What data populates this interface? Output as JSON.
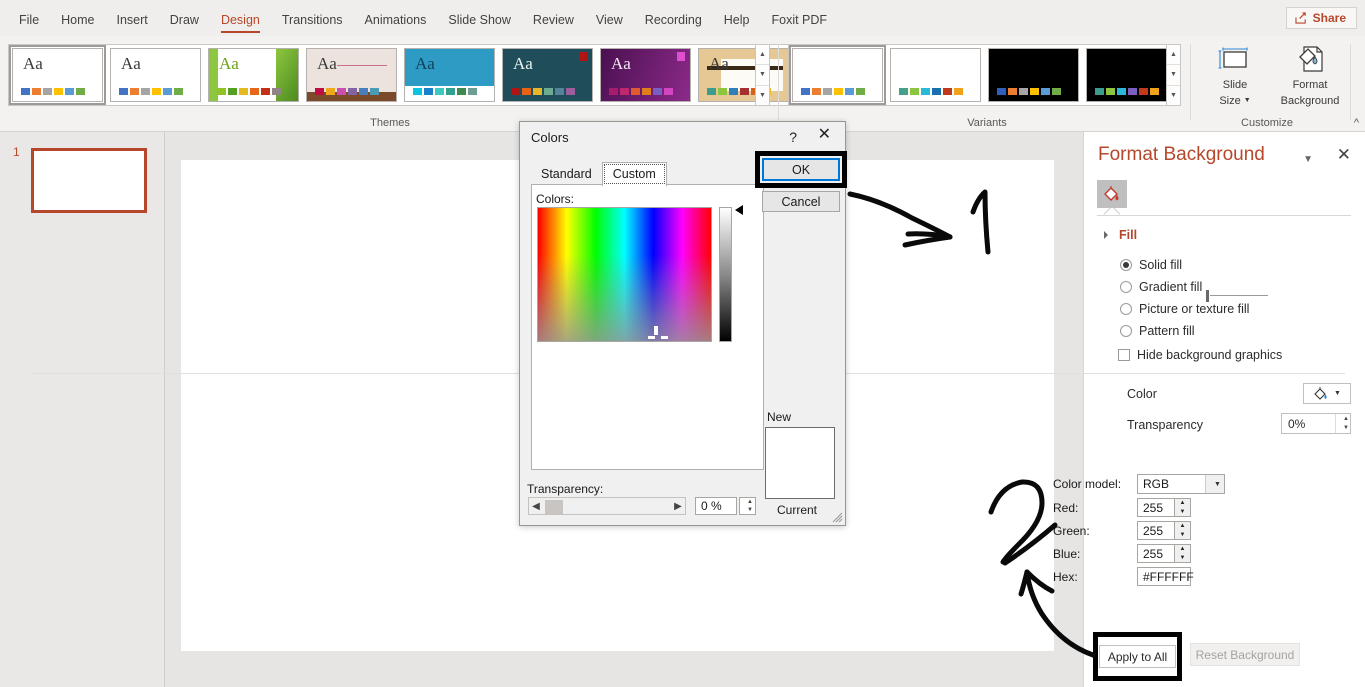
{
  "titlebar": {
    "share_label": "Share",
    "share_icon": "share-icon"
  },
  "ribbon": {
    "tabs": [
      {
        "label": "File"
      },
      {
        "label": "Home"
      },
      {
        "label": "Insert"
      },
      {
        "label": "Draw"
      },
      {
        "label": "Design"
      },
      {
        "label": "Transitions"
      },
      {
        "label": "Animations"
      },
      {
        "label": "Slide Show"
      },
      {
        "label": "Review"
      },
      {
        "label": "View"
      },
      {
        "label": "Recording"
      },
      {
        "label": "Help"
      },
      {
        "label": "Foxit PDF"
      }
    ],
    "active_tab": "Design",
    "groups": {
      "themes_label": "Themes",
      "variants_label": "Variants",
      "customize_label": "Customize"
    },
    "themes": [
      {
        "name": "office-theme",
        "aa": "Aa",
        "bg": "#ffffff",
        "fg": "#3a3a3a",
        "swatches": [
          "#4472c4",
          "#ed7d31",
          "#a5a5a5",
          "#ffc000",
          "#5b9bd5",
          "#70ad47"
        ]
      },
      {
        "name": "office-theme-2",
        "aa": "Aa",
        "bg": "#ffffff",
        "fg": "#3a3a3a",
        "swatches": [
          "#4472c4",
          "#ed7d31",
          "#a5a5a5",
          "#ffc000",
          "#5b9bd5",
          "#70ad47"
        ]
      },
      {
        "name": "facet-theme",
        "aa": "Aa",
        "bg": "#ffffff",
        "fg": "#6aa313",
        "swatches": [
          "#90c226",
          "#54a021",
          "#e6b91e",
          "#e76618",
          "#c42f1a",
          "#918485"
        ]
      },
      {
        "name": "wisp-theme",
        "aa": "Aa",
        "bg": "#ece3de",
        "fg": "#2b2b2b",
        "swatches": [
          "#bf0c43",
          "#f0a81a",
          "#cc4fad",
          "#8264a0",
          "#4a7ebb",
          "#4a9bb5"
        ]
      },
      {
        "name": "badge-theme",
        "aa": "Aa",
        "bg": "#2e9bc5",
        "fg": "#13405c",
        "swatches": [
          "#0ec3e0",
          "#1a82c9",
          "#3ec9c0",
          "#31a190",
          "#3f8a4f",
          "#6c9e93"
        ]
      },
      {
        "name": "ion-boardroom-dark",
        "aa": "Aa",
        "bg": "#1f4e5a",
        "fg": "#e9f1f2",
        "swatches": [
          "#b01513",
          "#ea6312",
          "#e6b729",
          "#6bab90",
          "#55839a",
          "#9e5d9d"
        ]
      },
      {
        "name": "berlin-theme",
        "aa": "Aa",
        "bg": "#6b1f6e",
        "fg": "#f3e8f4",
        "swatches": [
          "#a61c6a",
          "#c0286e",
          "#dd5b2e",
          "#e07d1d",
          "#7a5ec2",
          "#d445c4"
        ]
      },
      {
        "name": "wood-type-theme",
        "aa": "Aa",
        "bg": "#e6c894",
        "fg": "#2b2b2b",
        "swatches": [
          "#3c9c8e",
          "#8cbf3f",
          "#2e80b8",
          "#a63030",
          "#d4621d",
          "#e8bb2a"
        ]
      }
    ],
    "variants": [
      {
        "name": "variant-white-1",
        "bg": "#ffffff",
        "swatches": [
          "#4472c4",
          "#ed7d31",
          "#a5a5a5",
          "#ffc000",
          "#5b9bd5",
          "#70ad47"
        ]
      },
      {
        "name": "variant-white-2",
        "bg": "#ffffff",
        "swatches": [
          "#43a08a",
          "#8cc63e",
          "#29b8d8",
          "#1a6fad",
          "#c0391b",
          "#f0a21a"
        ]
      },
      {
        "name": "variant-black-1",
        "bg": "#000000",
        "swatches": [
          "#2f5fbd",
          "#ed7d31",
          "#a5a5a5",
          "#ffc000",
          "#5b9bd5",
          "#70ad47"
        ]
      },
      {
        "name": "variant-black-2",
        "bg": "#000000",
        "swatches": [
          "#3c9c8e",
          "#8cc63e",
          "#29b8d8",
          "#7a5ec2",
          "#c0391b",
          "#f0a21a"
        ]
      }
    ],
    "customize": {
      "slide_size_label": "Slide\nSize",
      "slide_size_line1": "Slide",
      "slide_size_line2": "Size",
      "format_background_line1": "Format",
      "format_background_line2": "Background",
      "collapse_icon": "chevron-up-icon"
    },
    "gallery_scroll": {
      "up": "▲",
      "down": "▼",
      "more": "▼"
    }
  },
  "slide_pane": {
    "slide_number": "1"
  },
  "format_background": {
    "title": "Format Background",
    "caret_icon": "chevron-down-icon",
    "close_icon": "close-icon",
    "tab_icon": "paint-bucket-icon",
    "fill_section": "Fill",
    "options": [
      {
        "label": "Solid fill",
        "accel": "S",
        "selected": true
      },
      {
        "label": "Gradient fill",
        "accel": "G",
        "selected": false
      },
      {
        "label": "Picture or texture fill",
        "accel": "P",
        "selected": false
      },
      {
        "label": "Pattern fill",
        "accel": "a",
        "selected": false
      }
    ],
    "hide_bg_label": "Hide background graphics",
    "hide_bg_checked": false,
    "color_label": "Color",
    "color_icon": "paint-bucket-icon",
    "transparency_label": "Transparency",
    "transparency_value": "0%",
    "apply_to_all": "Apply to All",
    "reset_background": "Reset Background"
  },
  "colors_dialog": {
    "title": "Colors",
    "help_icon": "question-mark-icon",
    "close_icon": "close-icon",
    "tabs": [
      {
        "label": "Standard",
        "active": false
      },
      {
        "label": "Custom",
        "active": true
      }
    ],
    "colors_label": "Colors:",
    "color_model_label": "Color model:",
    "color_model_value": "RGB",
    "fields": [
      {
        "label": "Red:",
        "accel": "R",
        "value": "255"
      },
      {
        "label": "Green:",
        "accel": "G",
        "value": "255"
      },
      {
        "label": "Blue:",
        "accel": "B",
        "value": "255"
      }
    ],
    "hex_label": "Hex:",
    "hex_value": "#FFFFFF",
    "transparency_label": "Transparency:",
    "transparency_value": "0 %",
    "preview_new_label": "New",
    "preview_current_label": "Current",
    "preview_color": "#FFFFFF",
    "ok_label": "OK",
    "cancel_label": "Cancel"
  },
  "annotations": {
    "marker_1": "1",
    "marker_2": "2",
    "highlight_color": "#000000",
    "focus_color": "#0078d7"
  }
}
